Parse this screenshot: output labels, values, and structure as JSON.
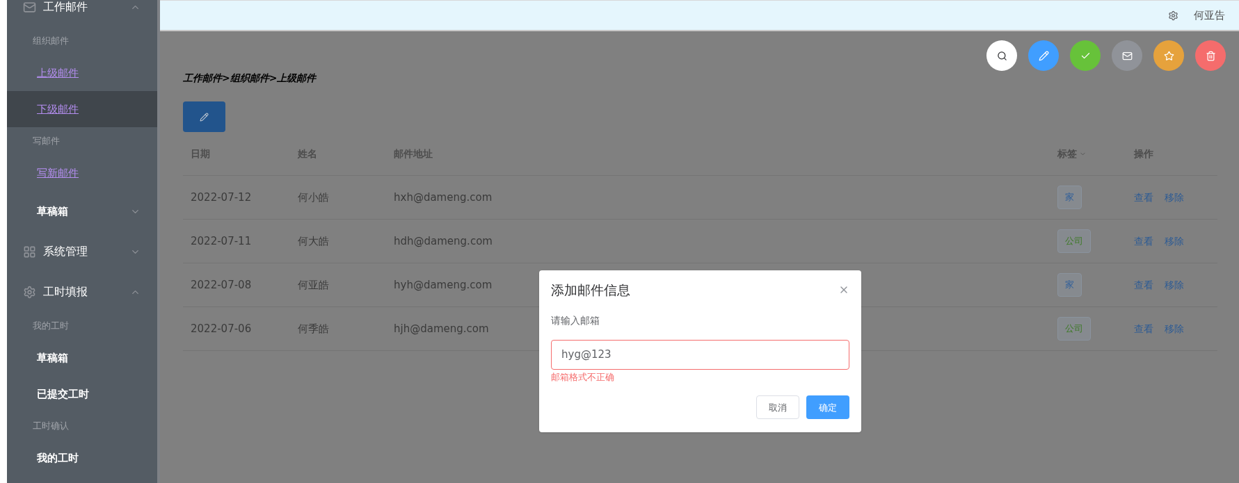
{
  "sidebar": {
    "sections": [
      {
        "title": "工作邮件",
        "expanded": true,
        "children": [
          {
            "kind": "group-title",
            "label": "组织邮件"
          },
          {
            "kind": "link",
            "label": "上级邮件",
            "selected": false
          },
          {
            "kind": "link",
            "label": "下级邮件",
            "selected": true
          },
          {
            "kind": "group-title",
            "label": "写邮件"
          },
          {
            "kind": "link",
            "label": "写新邮件",
            "selected": false
          },
          {
            "kind": "submenu",
            "label": "草稿箱",
            "expanded": false
          }
        ]
      },
      {
        "title": "系统管理",
        "expanded": false
      },
      {
        "title": "工时填报",
        "expanded": true,
        "children": [
          {
            "kind": "group-title",
            "label": "我的工时"
          },
          {
            "kind": "item",
            "label": "草稿箱",
            "selected": false
          },
          {
            "kind": "item",
            "label": "已提交工时",
            "selected": false
          },
          {
            "kind": "group-title",
            "label": "工时确认"
          },
          {
            "kind": "item",
            "label": "我的工时",
            "selected": false
          }
        ]
      }
    ]
  },
  "header": {
    "user": "何亚告"
  },
  "toolbar": [
    {
      "color": "#ffffff"
    },
    {
      "color": "#409eff"
    },
    {
      "color": "#67c23a"
    },
    {
      "color": "#909399"
    },
    {
      "color": "#e6a23c"
    },
    {
      "color": "#f56c6c"
    }
  ],
  "breadcrumb": "工作邮件>组织邮件>上级邮件",
  "table": {
    "columns": [
      "日期",
      "姓名",
      "邮件地址",
      "标签",
      "操作"
    ],
    "rows": [
      {
        "date": "2022-07-12",
        "name": "何小皓",
        "email": "hxh@dameng.com",
        "tag": {
          "label": "家",
          "color": "#2f5f9a"
        },
        "actions": [
          "查看",
          "移除"
        ]
      },
      {
        "date": "2022-07-11",
        "name": "何大皓",
        "email": "hdh@dameng.com",
        "tag": {
          "label": "公司",
          "color": "#3f7a28"
        },
        "actions": [
          "查看",
          "移除"
        ]
      },
      {
        "date": "2022-07-08",
        "name": "何亚皓",
        "email": "hyh@dameng.com",
        "tag": {
          "label": "家",
          "color": "#2f5f9a"
        },
        "actions": [
          "查看",
          "移除"
        ]
      },
      {
        "date": "2022-07-06",
        "name": "何季皓",
        "email": "hjh@dameng.com",
        "tag": {
          "label": "公司",
          "color": "#3f7a28"
        },
        "actions": [
          "查看",
          "移除"
        ]
      }
    ]
  },
  "dialog": {
    "title": "添加邮件信息",
    "label": "请输入邮箱",
    "value": "hyg@123",
    "invalid": true,
    "error": "邮箱格式不正确",
    "buttons": [
      {
        "label": "取消",
        "kind": "default"
      },
      {
        "label": "确定",
        "kind": "primary"
      }
    ]
  }
}
